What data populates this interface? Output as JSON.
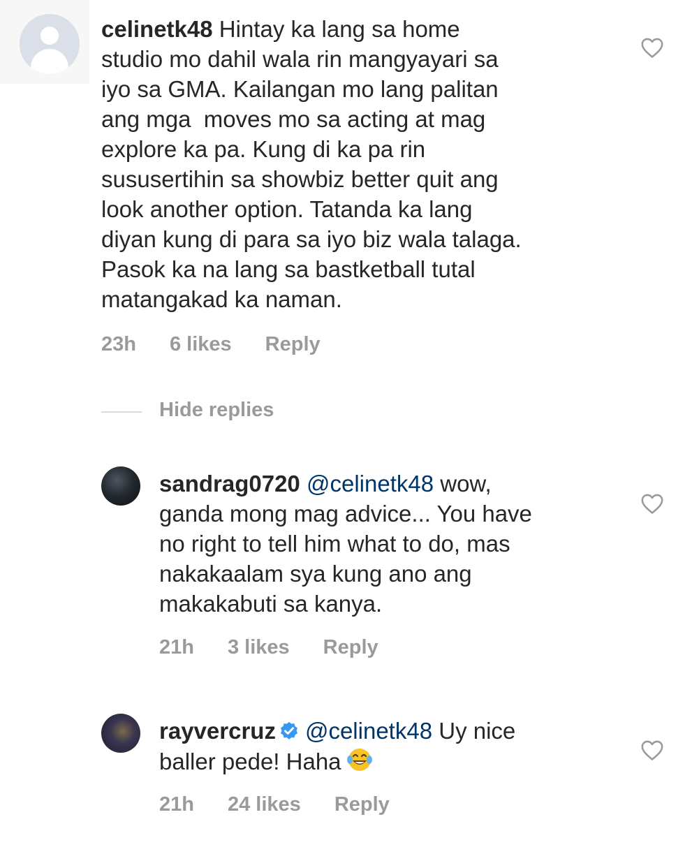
{
  "comments": [
    {
      "username": "celinetk48",
      "text": "Hintay ka lang sa home\nstudio mo dahil wala rin mangyayari sa\niyo sa GMA. Kailangan mo lang palitan\nang mga  moves mo sa acting at mag\nexplore ka pa. Kung di ka pa rin\nsususertihin sa showbiz better quit ang\nlook another option. Tatanda ka lang\ndiyan kung di para sa iyo biz wala talaga.\nPasok ka na lang sa bastketball tutal\nmatangakad ka naman.",
      "first_line": " Hintay ka lang sa home",
      "rest": "studio mo dahil wala rin mangyayari sa\niyo sa GMA. Kailangan mo lang palitan\nang mga  moves mo sa acting at mag\nexplore ka pa. Kung di ka pa rin\nsususertihin sa showbiz better quit ang\nlook another option. Tatanda ka lang\ndiyan kung di para sa iyo biz wala talaga.\nPasok ka na lang sa bastketball tutal\nmatangakad ka naman.",
      "time": "23h",
      "likes": "6 likes",
      "reply": "Reply"
    }
  ],
  "hide_replies": "Hide replies",
  "replies": [
    {
      "username": "sandrag0720",
      "mention": "@celinetk48",
      "first_line_rest": " wow,",
      "rest": "ganda mong mag advice... You have\nno right to tell him what to do, mas\nnakakaalam sya kung ano ang\nmakakabuti sa kanya.",
      "time": "21h",
      "likes": "3 likes",
      "reply": "Reply"
    },
    {
      "username": "rayvercruz",
      "verified": true,
      "mention": "@celinetk48",
      "first_line_rest": " Uy nice",
      "rest": "baller pede! Haha",
      "emoji": "face-with-tears-of-joy",
      "time": "21h",
      "likes": "24 likes",
      "reply": "Reply"
    }
  ],
  "colors": {
    "text": "#262626",
    "meta": "#9a9a9a",
    "mention": "#003569",
    "verified": "#3897f0"
  }
}
